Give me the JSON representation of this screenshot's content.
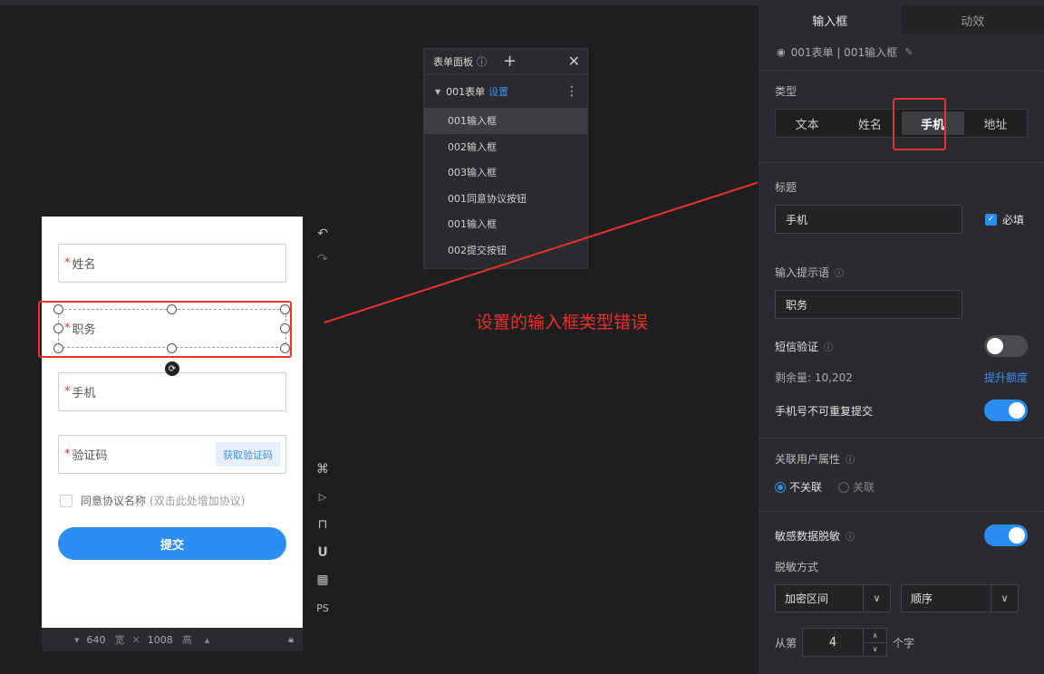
{
  "form_panel": {
    "title": "表单面板",
    "info_icon": "info-icon",
    "group_name": "001表单",
    "group_setting": "设置",
    "items": [
      "001输入框",
      "002输入框",
      "003输入框",
      "001同意协议按钮",
      "001输入框",
      "002提交按钮"
    ]
  },
  "phone_form": {
    "fields": [
      {
        "required": "*",
        "label": "姓名"
      },
      {
        "required": "*",
        "label": "职务"
      },
      {
        "required": "*",
        "label": "手机"
      },
      {
        "required": "*",
        "label": "验证码"
      }
    ],
    "sms_button": "获取验证码",
    "agree_label": "同意协议名称",
    "agree_hint": "(双击此处增加协议)",
    "submit_label": "提交"
  },
  "size_bar": {
    "width": "640",
    "width_label": "宽",
    "height": "1008",
    "height_label": "高"
  },
  "tools": {
    "ps_label": "PS"
  },
  "annotation": "设置的输入框类型错误",
  "sidebar": {
    "tabs": [
      "输入框",
      "动效"
    ],
    "breadcrumb": "001表单 | 001输入框",
    "type_label": "类型",
    "types": [
      "文本",
      "姓名",
      "手机",
      "地址"
    ],
    "selected_type": "手机",
    "title_label": "标题",
    "title_value": "手机",
    "required_label": "必填",
    "placeholder_label": "输入提示语",
    "placeholder_value": "职务",
    "sms_verify_label": "短信验证",
    "remaining_label": "剩余量: 10,202",
    "upgrade_link": "提升额度",
    "no_repeat_label": "手机号不可重复提交",
    "link_user_label": "关联用户属性",
    "link_options": [
      "不关联",
      "关联"
    ],
    "desensitize_label": "敏感数据脱敏",
    "desensitize_method_label": "脱敏方式",
    "method_select": "加密区间",
    "order_select": "顺序",
    "from_label": "从第",
    "from_value": "4",
    "unit_label": "个字"
  }
}
